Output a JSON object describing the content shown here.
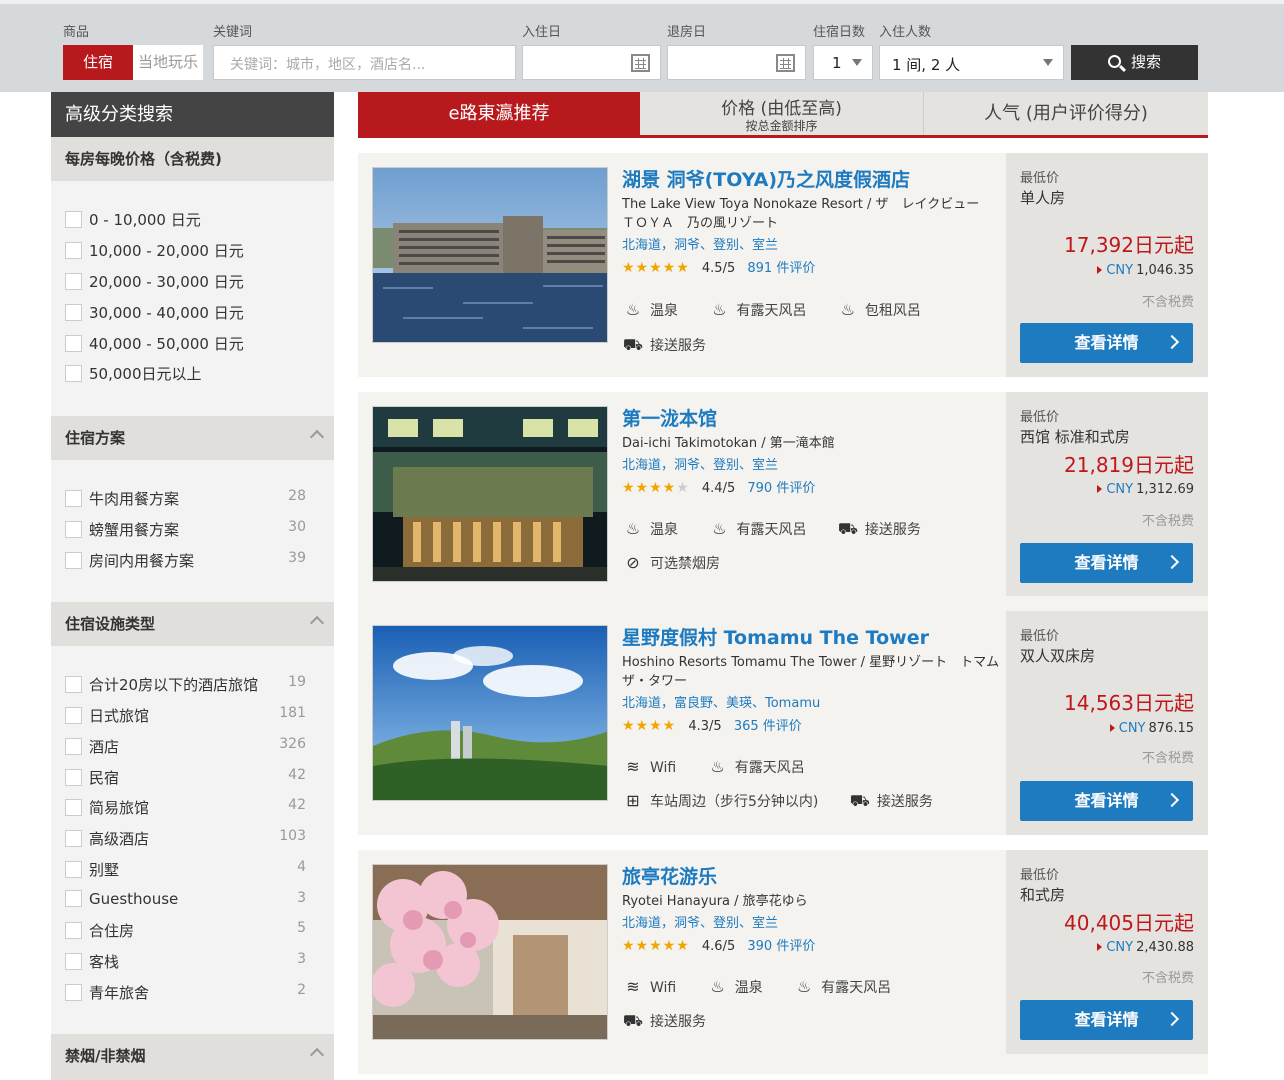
{
  "search": {
    "label_product": "商品",
    "label_keyword": "关键词",
    "label_checkin": "入住日",
    "label_checkout": "退房日",
    "label_nights": "住宿日数",
    "label_guests": "入住人数",
    "tab_stay": "住宿",
    "tab_local": "当地玩乐",
    "keyword_placeholder": "关键词：城市，地区，酒店名...",
    "checkin_value": "",
    "checkout_value": "",
    "nights_value": "1",
    "guests_value": "1 间, 2 人",
    "button_label": "搜索"
  },
  "sidebar": {
    "title": "高级分类搜索",
    "price_section": {
      "title": "每房每晚价格（含税费)",
      "options": [
        "0 - 10,000 日元",
        "10,000 - 20,000 日元",
        "20,000 - 30,000 日元",
        "30,000 - 40,000 日元",
        "40,000 - 50,000 日元",
        "50,000日元以上"
      ]
    },
    "plan_section": {
      "title": "住宿方案",
      "options": [
        {
          "label": "牛肉用餐方案",
          "count": "28"
        },
        {
          "label": "螃蟹用餐方案",
          "count": "30"
        },
        {
          "label": "房间内用餐方案",
          "count": "39"
        }
      ]
    },
    "type_section": {
      "title": "住宿设施类型",
      "options": [
        {
          "label": "合计20房以下的酒店旅馆",
          "count": "19"
        },
        {
          "label": "日式旅馆",
          "count": "181"
        },
        {
          "label": "酒店",
          "count": "326"
        },
        {
          "label": "民宿",
          "count": "42"
        },
        {
          "label": "简易旅馆",
          "count": "42"
        },
        {
          "label": "高级酒店",
          "count": "103"
        },
        {
          "label": "别墅",
          "count": "4"
        },
        {
          "label": "Guesthouse",
          "count": "3"
        },
        {
          "label": "合住房",
          "count": "5"
        },
        {
          "label": "客栈",
          "count": "3"
        },
        {
          "label": "青年旅舍",
          "count": "2"
        }
      ]
    },
    "smoking_section": {
      "title": "禁烟/非禁烟"
    }
  },
  "sort": {
    "tab1": "e路東瀛推荐",
    "tab2": "价格 (由低至高)",
    "tab2_sub": "按总金额排序",
    "tab3": "人气 (用户评价得分)"
  },
  "hotels": [
    {
      "name": "湖景 洞爷(TOYA)乃之风度假酒店",
      "subname": "The Lake View Toya Nonokaze Resort / ザ　レイクビュー　ＴＯＹＡ　乃の風リゾート",
      "location": "北海道，洞爷、登别、室兰",
      "stars": "★★★★★",
      "stars_empty": "",
      "score": "4.5/5",
      "reviews": "891 件评价",
      "amenities_row1": [
        "温泉",
        "有露天风呂",
        "包租风呂"
      ],
      "amenities_row2": [
        "接送服务"
      ],
      "price_label": "最低价",
      "room": "单人房",
      "price": "17,392日元起",
      "cny_label": "CNY",
      "cny": "1,046.35",
      "tax": "不含税费",
      "button": "查看详情"
    },
    {
      "name": "第一泷本馆",
      "subname": "Dai-ichi Takimotokan / 第一滝本館",
      "location": "北海道，洞爷、登别、室兰",
      "stars": "★★★★",
      "stars_empty": "★",
      "score": "4.4/5",
      "reviews": "790 件评价",
      "amenities_row1": [
        "温泉",
        "有露天风呂",
        "接送服务"
      ],
      "amenities_row2": [
        "可选禁烟房"
      ],
      "price_label": "最低价",
      "room": "西馆 标准和式房",
      "price": "21,819日元起",
      "cny_label": "CNY",
      "cny": "1,312.69",
      "tax": "不含税费",
      "button": "查看详情"
    },
    {
      "name": "星野度假村 Tomamu The Tower",
      "subname": "Hoshino Resorts Tomamu The Tower / 星野リゾート　トマム　ザ・タワー",
      "location": "北海道，富良野、美瑛、Tomamu",
      "stars": "★★★★",
      "stars_empty": "",
      "score": "4.3/5",
      "reviews": "365 件评价",
      "amenities_row1": [
        "Wifi",
        "有露天风呂"
      ],
      "amenities_row2": [
        "车站周边（步行5分钟以内)",
        "接送服务"
      ],
      "price_label": "最低价",
      "room": "双人双床房",
      "price": "14,563日元起",
      "cny_label": "CNY",
      "cny": "876.15",
      "tax": "不含税费",
      "button": "查看详情"
    },
    {
      "name": "旅亭花游乐",
      "subname": "Ryotei Hanayura / 旅亭花ゆら",
      "location": "北海道，洞爷、登别、室兰",
      "stars": "★★★★★",
      "stars_empty": "",
      "score": "4.6/5",
      "reviews": "390 件评价",
      "amenities_row1": [
        "Wifi",
        "温泉",
        "有露天风呂"
      ],
      "amenities_row2": [
        "接送服务"
      ],
      "price_label": "最低价",
      "room": "和式房",
      "price": "40,405日元起",
      "cny_label": "CNY",
      "cny": "2,430.88",
      "tax": "不含税费",
      "button": "查看详情"
    }
  ],
  "colors": {
    "brand_red": "#b7191c",
    "link_blue": "#1e7bbf",
    "price_red": "#c0171b"
  }
}
